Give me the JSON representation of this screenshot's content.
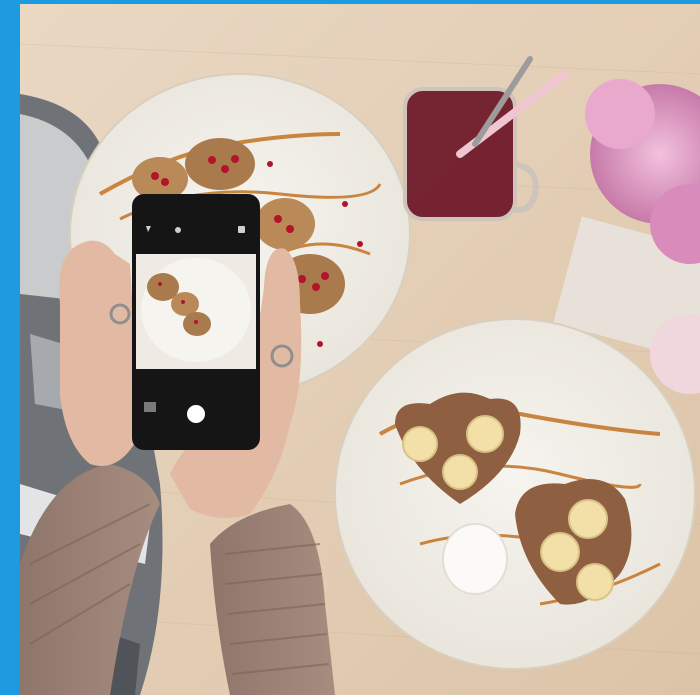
{
  "frame": {
    "accent": "#1e9be0"
  },
  "photo": {
    "table_color": "#e6d2bb",
    "plate_color": "#f1efe9",
    "syrup_color": "#c9853f",
    "drink_color": "#6b1525",
    "flower_color": "#e3a3c7",
    "icons": [
      "flash-icon",
      "timer-icon",
      "camera-switch-icon",
      "gallery-thumbnail-icon"
    ]
  }
}
